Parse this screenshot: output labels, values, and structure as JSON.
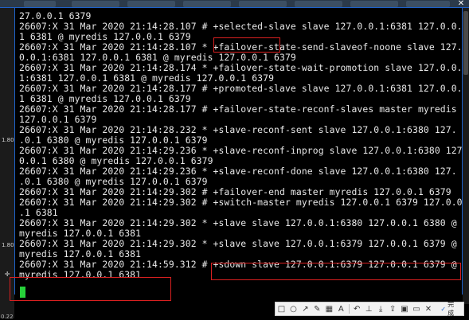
{
  "window": {
    "close_glyph": "✕",
    "accent_color": "#1e62c9"
  },
  "gutter": {
    "labels": [
      "1.80",
      "1.80"
    ],
    "cross_glyph": "✛",
    "bottom_label": "0.22"
  },
  "terminal": {
    "lines": [
      "27.0.0.1 6379",
      "26607:X 31 Mar 2020 21:14:28.107 # +selected-slave slave 127.0.0.1:6381 127.0.0.",
      "1 6381 @ myredis 127.0.0.1 6379",
      "26607:X 31 Mar 2020 21:14:28.107 * +failover-state-send-slaveof-noone slave 127.",
      "0.0.1:6381 127.0.0.1 6381 @ myredis 127.0.0.1 6379",
      "26607:X 31 Mar 2020 21:14:28.174 * +failover-state-wait-promotion slave 127.0.0.",
      "1:6381 127.0.0.1 6381 @ myredis 127.0.0.1 6379",
      "26607:X 31 Mar 2020 21:14:28.177 # +promoted-slave slave 127.0.0.1:6381 127.0.0.",
      "1 6381 @ myredis 127.0.0.1 6379",
      "26607:X 31 Mar 2020 21:14:28.177 # +failover-state-reconf-slaves master myredis",
      "127.0.0.1 6379",
      "26607:X 31 Mar 2020 21:14:28.232 * +slave-reconf-sent slave 127.0.0.1:6380 127.",
      ".0.1 6380 @ myredis 127.0.0.1 6379",
      "26607:X 31 Mar 2020 21:14:29.236 * +slave-reconf-inprog slave 127.0.0.1:6380 127",
      "0.0.1 6380 @ myredis 127.0.0.1 6379",
      "26607:X 31 Mar 2020 21:14:29.236 * +slave-reconf-done slave 127.0.0.1:6380 127.",
      ".0.1 6380 @ myredis 127.0.0.1 6379",
      "26607:X 31 Mar 2020 21:14:29.302 # +failover-end master myredis 127.0.0.1 6379",
      "26607:X 31 Mar 2020 21:14:29.302 # +switch-master myredis 127.0.0.1 6379 127.0.0",
      ".1 6381",
      "26607:X 31 Mar 2020 21:14:29.302 * +slave slave 127.0.0.1:6380 127.0.0.1 6380 @",
      "myredis 127.0.0.1 6381",
      "26607:X 31 Mar 2020 21:14:29.302 * +slave slave 127.0.0.1:6379 127.0.0.1 6379 @",
      "myredis 127.0.0.1 6381",
      "26607:X 31 Mar 2020 21:14:59.312 # +sdown slave 127.0.0.1:6379 127.0.0.1 6379 @",
      "myredis 127.0.0.1 6381"
    ],
    "text_color": "#e8e8e8",
    "cursor_color": "#27d13a",
    "highlight_color": "#d92020"
  },
  "toolbar": {
    "tools": [
      {
        "icon": "rectangle-icon",
        "glyph": "□"
      },
      {
        "icon": "ellipse-icon",
        "glyph": "○"
      },
      {
        "icon": "arrow-icon",
        "glyph": "↗"
      },
      {
        "icon": "pen-icon",
        "glyph": "✎"
      },
      {
        "icon": "mosaic-icon",
        "glyph": "▦"
      },
      {
        "icon": "text-icon",
        "glyph": "A"
      },
      {
        "icon": "undo-icon",
        "glyph": "↶"
      },
      {
        "icon": "pin-icon",
        "glyph": "⊥"
      },
      {
        "icon": "download-icon",
        "glyph": "⤓"
      },
      {
        "icon": "share-icon",
        "glyph": "⇪"
      },
      {
        "icon": "save-icon",
        "glyph": "▣"
      },
      {
        "icon": "screen-icon",
        "glyph": "▭"
      },
      {
        "icon": "close-icon",
        "glyph": "✕"
      }
    ],
    "done_glyph": "✓",
    "done_label": "完成"
  }
}
